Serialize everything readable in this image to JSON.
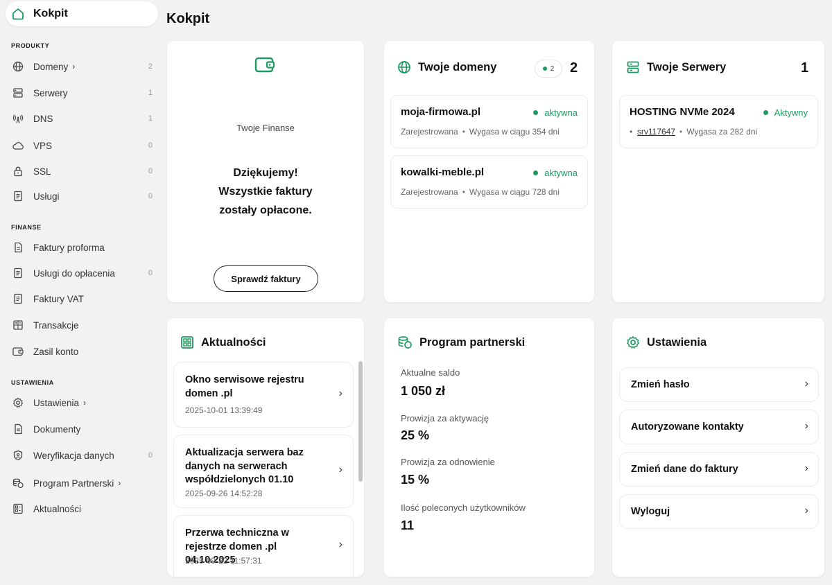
{
  "sidebar": {
    "home_label": "Kokpit",
    "sections": {
      "produkty": "PRODUKTY",
      "finanse": "FINANSE",
      "ustawienia": "USTAWIENIA"
    },
    "produkty_items": [
      {
        "label": "Domeny",
        "count": "2",
        "icon": "globe-icon",
        "has_chevron": true
      },
      {
        "label": "Serwery",
        "count": "1",
        "icon": "server-icon"
      },
      {
        "label": "DNS",
        "count": "1",
        "icon": "antenna-icon"
      },
      {
        "label": "VPS",
        "count": "0",
        "icon": "cloud-icon"
      },
      {
        "label": "SSL",
        "count": "0",
        "icon": "lock-icon"
      },
      {
        "label": "Usługi",
        "count": "0",
        "icon": "document-icon"
      }
    ],
    "finanse_items": [
      {
        "label": "Faktury proforma",
        "icon": "document-icon"
      },
      {
        "label": "Usługi do opłacenia",
        "count": "0",
        "icon": "document-icon"
      },
      {
        "label": "Faktury VAT",
        "icon": "document-icon"
      },
      {
        "label": "Transakcje",
        "icon": "calculator-icon"
      },
      {
        "label": "Zasil konto",
        "icon": "wallet-icon"
      }
    ],
    "ustawienia_items": [
      {
        "label": "Ustawienia",
        "icon": "gear-icon",
        "has_chevron": true
      },
      {
        "label": "Dokumenty",
        "icon": "document-icon"
      },
      {
        "label": "Weryfikacja danych",
        "count": "0",
        "icon": "shield-icon"
      },
      {
        "label": "Program Partnerski",
        "icon": "coins-icon",
        "has_chevron": true
      },
      {
        "label": "Aktualności",
        "icon": "news-icon"
      }
    ],
    "chevron": "›"
  },
  "page": {
    "title": "Kokpit"
  },
  "finance": {
    "label": "Twoje Finanse",
    "message_line1": "Dziękujemy!",
    "message_line2": "Wszystkie faktury",
    "message_line3": "zostały opłacone.",
    "button_label": "Sprawdź faktury"
  },
  "domains": {
    "title": "Twoje domeny",
    "badge_count": "2",
    "total": "2",
    "items": [
      {
        "name": "moja-firmowa.pl",
        "status": "aktywna",
        "registered": "Zarejestrowana",
        "sep": "•",
        "expires": "Wygasa w ciągu 354 dni"
      },
      {
        "name": "kowalki-meble.pl",
        "status": "aktywna",
        "registered": "Zarejestrowana",
        "sep": "•",
        "expires": "Wygasa w ciągu 728 dni"
      }
    ]
  },
  "servers": {
    "title": "Twoje Serwery",
    "total": "1",
    "items": [
      {
        "name": "HOSTING NVMe 2024",
        "status": "Aktywny",
        "bullet": "•",
        "id": "srv117647",
        "sep": "•",
        "expires": "Wygasa za 282 dni"
      }
    ]
  },
  "news": {
    "title": "Aktualności",
    "chevron": "›",
    "items": [
      {
        "title": "Okno serwisowe rejestru domen .pl",
        "date": "2025-10-01 13:39:49"
      },
      {
        "title": "Aktualizacja serwera baz danych na serwerach współdzielonych 01.10",
        "date": "2025-09-26 14:52:28"
      },
      {
        "title": "Przerwa techniczna w rejestrze domen .pl 04.10.2025",
        "date": "2025-09-22 11:57:31"
      }
    ]
  },
  "partner": {
    "title": "Program partnerski",
    "balance_label": "Aktualne saldo",
    "balance_value": "1 050 zł",
    "activation_label": "Prowizja za aktywację",
    "activation_value": "25 %",
    "renewal_label": "Prowizja za odnowienie",
    "renewal_value": "15 %",
    "referred_label": "Ilość poleconych użytkowników",
    "referred_value": "11"
  },
  "settings": {
    "title": "Ustawienia",
    "chevron": "›",
    "items": [
      {
        "label": "Zmień hasło"
      },
      {
        "label": "Autoryzowane kontakty"
      },
      {
        "label": "Zmień dane do faktury"
      },
      {
        "label": "Wyloguj"
      }
    ]
  },
  "colors": {
    "accent_green": "#1e9a61",
    "background": "#f2f2f2",
    "card": "#ffffff"
  }
}
